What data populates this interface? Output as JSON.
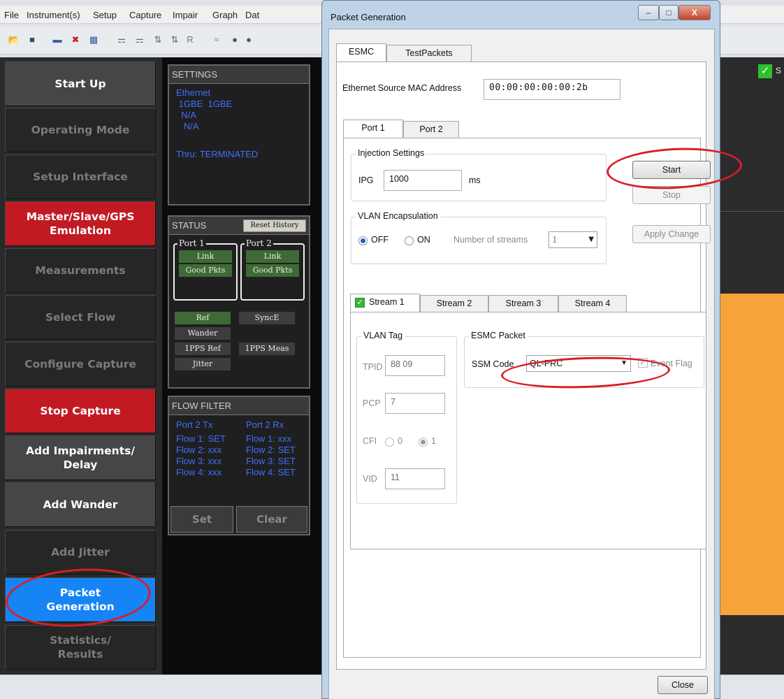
{
  "menu": [
    "File",
    "Instrument(s)",
    "Setup",
    "Capture",
    "Impair",
    "Graph",
    "Dat"
  ],
  "toolbar_icons": [
    "open-icon",
    "save-icon",
    "link-icon",
    "disconnect-icon",
    "port-icon",
    "inf-icon",
    "cnf-icon",
    "sync-icon",
    "sync2-icon",
    "r-icon",
    "wave-icon",
    "dot-icon"
  ],
  "toolbar_r": "R",
  "sidebar": [
    {
      "label": "Start Up",
      "state": "active"
    },
    {
      "label": "Operating Mode",
      "state": "disabled"
    },
    {
      "label": "Setup Interface",
      "state": "disabled"
    },
    {
      "label": "Master/Slave/GPS\nEmulation",
      "state": "red"
    },
    {
      "label": "Measurements",
      "state": "disabled"
    },
    {
      "label": "Select Flow",
      "state": "disabled"
    },
    {
      "label": "Configure Capture",
      "state": "disabled"
    },
    {
      "label": "Stop Capture",
      "state": "red"
    },
    {
      "label": "Add Impairments/\nDelay",
      "state": "active"
    },
    {
      "label": "Add Wander",
      "state": "active"
    },
    {
      "label": "Add Jitter",
      "state": "disabled"
    },
    {
      "label": "Packet\nGeneration",
      "state": "blue"
    },
    {
      "label": "Statistics/\nResults",
      "state": "disabled"
    }
  ],
  "settings": {
    "title": "SETTINGS",
    "lines": [
      "Ethernet",
      " 1GBE  1GBE",
      "  N/A",
      "   N/A",
      "",
      "Thru: TERMINATED"
    ]
  },
  "status": {
    "title": "STATUS",
    "reset_label": "Reset History",
    "port1": "Port 1",
    "port2": "Port 2",
    "link": "Link",
    "good": "Good Pkts",
    "ref": "Ref",
    "synce": "SyncE",
    "wander": "Wander",
    "pps_ref": "1PPS Ref",
    "pps_meas": "1PPS Meas",
    "jitter": "Jitter"
  },
  "flow_filter": {
    "title": "FLOW FILTER",
    "col1": [
      "Port 2 Tx",
      "Flow 1: SET",
      "Flow 2: xxx",
      "Flow 3: xxx",
      "Flow 4: xxx"
    ],
    "col2": [
      "Port 2 Rx",
      "Flow 1: xxx",
      "Flow 2: SET",
      "Flow 3: SET",
      "Flow 4: SET"
    ],
    "set_label": "Set",
    "clear_label": "Clear"
  },
  "right_edge_text": "S",
  "dialog": {
    "title": "Packet Generation",
    "min_glyph": "–",
    "max_glyph": "□",
    "close_glyph": "X",
    "tabs": [
      "ESMC",
      "TestPackets"
    ],
    "mac_label": "Ethernet Source MAC Address",
    "mac_value": "00:00:00:00:00:2b",
    "port_tabs": [
      "Port 1",
      "Port 2"
    ],
    "injection": {
      "title": "Injection Settings",
      "ipg_label": "IPG",
      "ipg_value": "1000",
      "unit": "ms"
    },
    "start_label": "Start",
    "stop_label": "Stop",
    "apply_label": "Apply Change",
    "vlan_enc": {
      "title": "VLAN Encapsulation",
      "off": "OFF",
      "on": "ON",
      "streams_label": "Number of streams",
      "streams_value": "1"
    },
    "stream_tabs": [
      "Stream 1",
      "Stream 2",
      "Stream 3",
      "Stream 4"
    ],
    "vlan_tag": {
      "title": "VLAN Tag",
      "tpid_label": "TPID",
      "tpid_value": "88 09",
      "pcp_label": "PCP",
      "pcp_value": "7",
      "cfi_label": "CFI",
      "cfi_0": "0",
      "cfi_1": "1",
      "vid_label": "VID",
      "vid_value": "11"
    },
    "esmc_packet": {
      "title": "ESMC Packet",
      "ssm_label": "SSM Code",
      "ssm_value": "QL-PRC",
      "event_label": "Event Flag"
    },
    "close_label": "Close"
  },
  "colors": {
    "highlight_ring": "#d81f26",
    "orange": "#f6a33a",
    "active_blue": "#1684f5",
    "alarm_red": "#c21a23"
  }
}
